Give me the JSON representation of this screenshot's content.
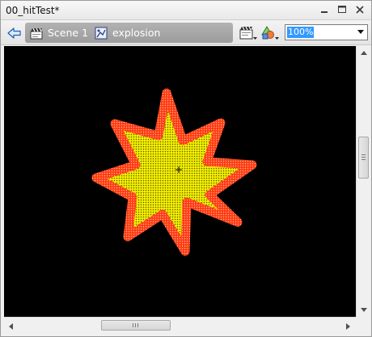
{
  "window": {
    "title": "00_hitTest*"
  },
  "breadcrumb": {
    "items": [
      {
        "label": "Scene 1",
        "icon": "clapperboard-icon"
      },
      {
        "label": "explosion",
        "icon": "movie-clip-icon"
      }
    ]
  },
  "toolbar": {
    "edit_scene_icon": "edit-scene-icon",
    "edit_symbol_icon": "edit-symbols-icon",
    "zoom_value": "100%"
  },
  "stage": {
    "background": "#000000",
    "shape": "explosion-starburst",
    "fill_color": "#f2ee00",
    "stroke_color": "#ff3b12",
    "registration_mark": "crosshair"
  }
}
